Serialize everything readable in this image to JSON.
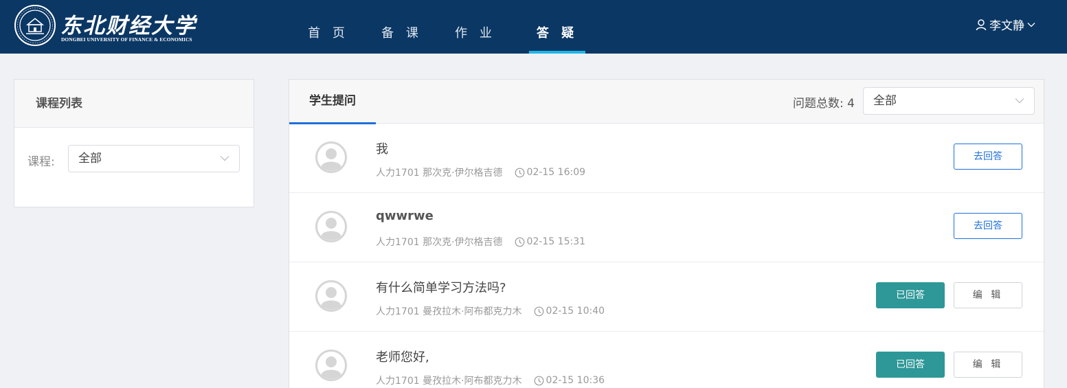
{
  "header": {
    "logo_cn": "东北财经大学",
    "logo_en": "DONGBEI UNIVERSITY OF FINANCE & ECONOMICS",
    "nav": [
      {
        "label": "首 页",
        "active": false
      },
      {
        "label": "备 课",
        "active": false
      },
      {
        "label": "作 业",
        "active": false
      },
      {
        "label": "答 疑",
        "active": true
      }
    ],
    "user_name": "李文静"
  },
  "sidebar": {
    "title": "课程列表",
    "course_label": "课程:",
    "course_value": "全部"
  },
  "main": {
    "tab_label": "学生提问",
    "count_label": "问题总数: 4",
    "filter_value": "全部",
    "questions": [
      {
        "title": "我",
        "author": "人力1701 那次克·伊尔格吉德",
        "time": "02-15 16:09",
        "answered": false,
        "answer_label": "去回答"
      },
      {
        "title": "qwwrwe",
        "author": "人力1701 那次克·伊尔格吉德",
        "time": "02-15 15:31",
        "answered": false,
        "answer_label": "去回答"
      },
      {
        "title": "有什么简单学习方法吗?",
        "author": "人力1701 曼孜拉木·阿布都克力木",
        "time": "02-15 10:40",
        "answered": true,
        "answered_label": "已回答",
        "edit_label": "编 辑"
      },
      {
        "title": "老师您好,",
        "author": "人力1701 曼孜拉木·阿布都克力木",
        "time": "02-15 10:36",
        "answered": true,
        "answered_label": "已回答",
        "edit_label": "编 辑"
      }
    ]
  },
  "colors": {
    "header_bg": "#0b3764",
    "active_nav_underline": "#1fb6e6",
    "tab_underline": "#1e6fd9",
    "answer_button": "#1e6fd9",
    "answered_button": "#2e9797"
  },
  "icons": [
    "university-seal-icon",
    "user-icon",
    "chevron-down-icon",
    "avatar-icon",
    "clock-icon"
  ]
}
